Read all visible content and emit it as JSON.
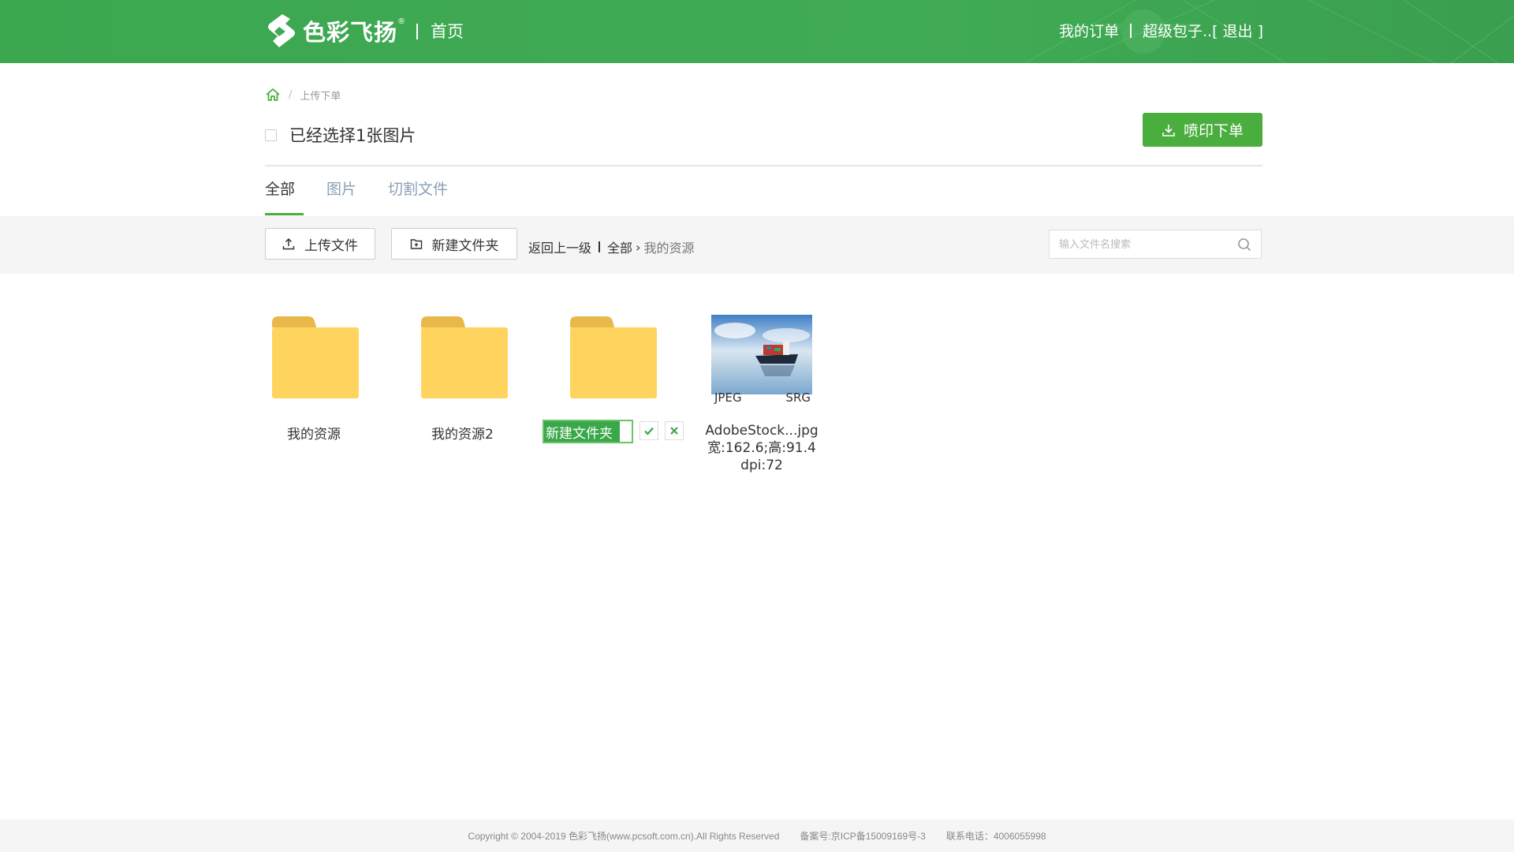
{
  "header": {
    "logo_text": "色彩飞扬",
    "logo_reg": "®",
    "home_label": "首页",
    "orders_label": "我的订单",
    "user_name": "超级包子..",
    "logout_label": "[ 退出 ]"
  },
  "breadcrumb": {
    "current": "上传下单"
  },
  "selection": {
    "text": "已经选择1张图片"
  },
  "actions": {
    "print_order_label": "喷印下单"
  },
  "tabs": [
    {
      "label": "全部",
      "active": true
    },
    {
      "label": "图片",
      "active": false
    },
    {
      "label": "切割文件",
      "active": false
    }
  ],
  "toolbar": {
    "upload_label": "上传文件",
    "new_folder_label": "新建文件夹",
    "back_label": "返回上一级",
    "path_root": "全部",
    "path_current": "我的资源",
    "search_placeholder": "输入文件名搜索"
  },
  "files": [
    {
      "type": "folder",
      "name": "我的资源"
    },
    {
      "type": "folder",
      "name": "我的资源2"
    },
    {
      "type": "folder",
      "name": "新建文件夹",
      "editing": true
    },
    {
      "type": "image",
      "name": "AdobeStock...jpg",
      "format": "JPEG",
      "colorspace": "SRG",
      "size_text": "宽:162.6;高:91.4",
      "dpi_text": "dpi:72"
    }
  ],
  "footer": {
    "copyright": "Copyright © 2004-2019 色彩飞扬(www.pcsoft.com.cn).All Rights Reserved",
    "icp": "备案号:京ICP备15009169号-3",
    "phone": "联系电话：4006055998"
  },
  "colors": {
    "brand_green": "#40ab55",
    "button_green": "#4aae3f",
    "folder_yellow": "#ffd45e"
  }
}
